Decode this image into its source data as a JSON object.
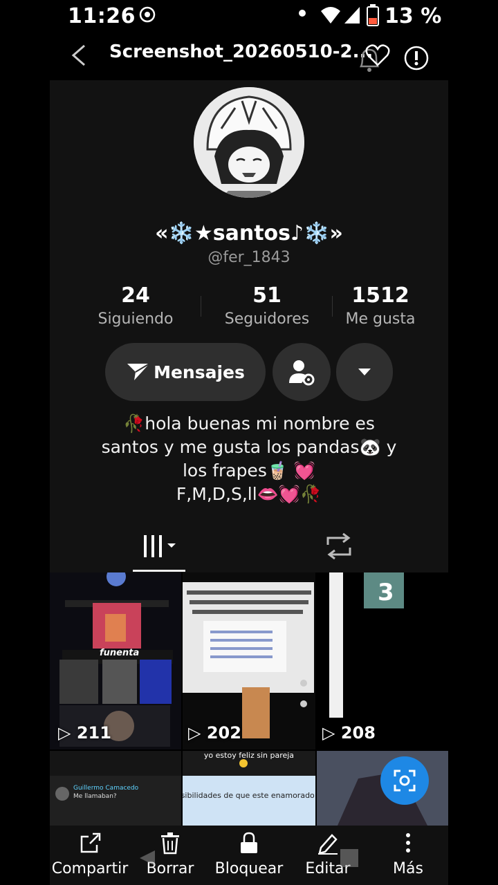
{
  "status_bar": {
    "time": "11:26",
    "battery": "13 %"
  },
  "header": {
    "title": "Screenshot_20260510-2..."
  },
  "profile": {
    "display_name": "«❄️★santos♪❄️»",
    "handle": "@fer_1843",
    "stats": [
      {
        "value": "24",
        "label": "Siguiendo"
      },
      {
        "value": "51",
        "label": "Seguidores"
      },
      {
        "value": "1512",
        "label": "Me gusta"
      }
    ],
    "message_button": "Mensajes",
    "bio_lines": [
      "🥀hola buenas mi nombre es",
      "santos y me gusta los pandas🐼 y",
      "los frapes🧋 💓",
      "F,M,D,S,ll👄💓🥀"
    ]
  },
  "videos": [
    {
      "views": "211"
    },
    {
      "views": "202"
    },
    {
      "views": "208"
    }
  ],
  "thumb_texts": {
    "t2_text": "mi posibilidades de que este enamorado de mi",
    "t2_header": "yo estoy feliz sin pareja",
    "t0_name": "funenta",
    "t3_num": "3",
    "comment_user": "Guillermo Camacedo",
    "comment_text": "Me llamaban?"
  },
  "bottom_bar": [
    {
      "icon": "share-icon",
      "label": "Compartir"
    },
    {
      "icon": "trash-icon",
      "label": "Borrar"
    },
    {
      "icon": "lock-icon",
      "label": "Bloquear"
    },
    {
      "icon": "edit-icon",
      "label": "Editar"
    },
    {
      "icon": "more-icon",
      "label": "Más"
    }
  ],
  "colors": {
    "accent": "#1e88e5",
    "panel": "#121212",
    "button": "#2f2f2f"
  }
}
